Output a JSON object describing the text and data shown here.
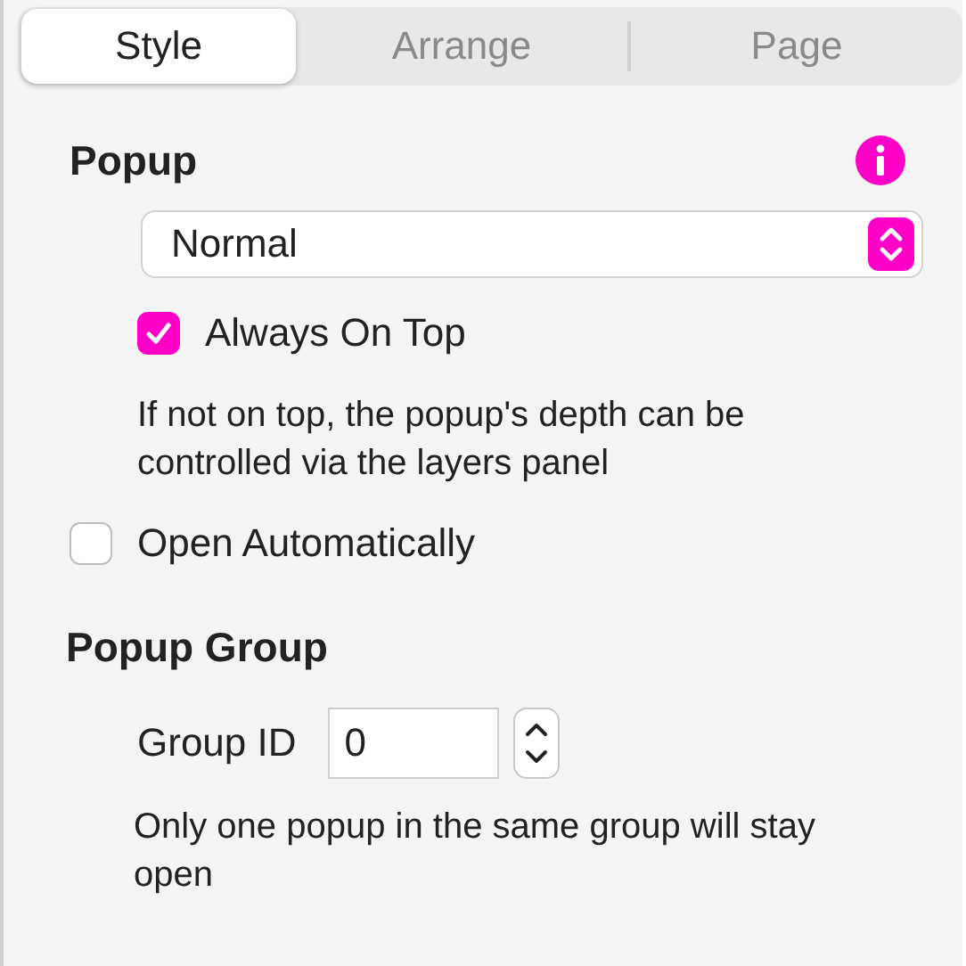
{
  "tabs": [
    {
      "label": "Style",
      "selected": true
    },
    {
      "label": "Arrange",
      "selected": false
    },
    {
      "label": "Page",
      "selected": false
    }
  ],
  "popup": {
    "heading": "Popup",
    "dropdown": {
      "value": "Normal"
    },
    "always_on_top": {
      "label": "Always On Top",
      "checked": true
    },
    "help": "If not on top, the popup's depth can be controlled via the layers panel",
    "open_automatically": {
      "label": "Open Automatically",
      "checked": false
    }
  },
  "popup_group": {
    "heading": "Popup Group",
    "group_id": {
      "label": "Group ID",
      "value": "0"
    },
    "help": "Only one popup in the same group will stay open"
  }
}
